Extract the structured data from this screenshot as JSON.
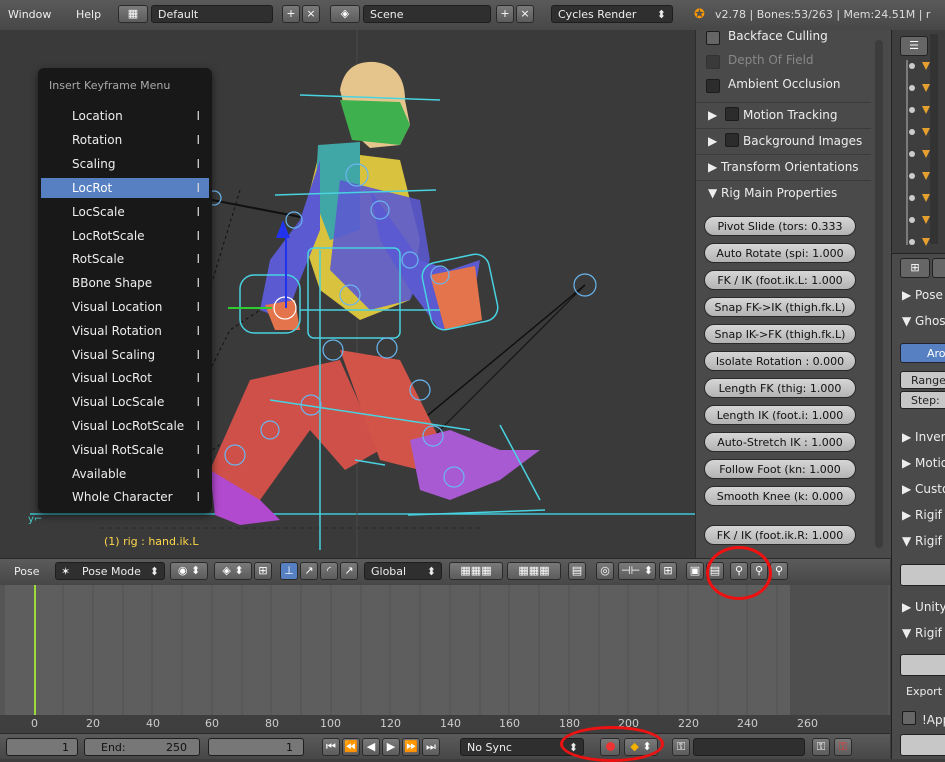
{
  "topbar": {
    "menu_window": "Window",
    "menu_help": "Help",
    "layout": "Default",
    "scene": "Scene",
    "render_engine": "Cycles Render",
    "stats": "v2.78 | Bones:53/263 | Mem:24.51M | r"
  },
  "kf_menu": {
    "title": "Insert Keyframe Menu",
    "items": [
      {
        "label": "Location",
        "shortcut": "I"
      },
      {
        "label": "Rotation",
        "shortcut": "I"
      },
      {
        "label": "Scaling",
        "shortcut": "I"
      },
      {
        "label": "LocRot",
        "shortcut": "I"
      },
      {
        "label": "LocScale",
        "shortcut": "I"
      },
      {
        "label": "LocRotScale",
        "shortcut": "I"
      },
      {
        "label": "RotScale",
        "shortcut": "I"
      },
      {
        "label": "BBone Shape",
        "shortcut": "I"
      },
      {
        "label": "Visual Location",
        "shortcut": "I"
      },
      {
        "label": "Visual Rotation",
        "shortcut": "I"
      },
      {
        "label": "Visual Scaling",
        "shortcut": "I"
      },
      {
        "label": "Visual LocRot",
        "shortcut": "I"
      },
      {
        "label": "Visual LocScale",
        "shortcut": "I"
      },
      {
        "label": "Visual LocRotScale",
        "shortcut": "I"
      },
      {
        "label": "Visual RotScale",
        "shortcut": "I"
      },
      {
        "label": "Available",
        "shortcut": "I"
      },
      {
        "label": "Whole Character",
        "shortcut": "I"
      }
    ]
  },
  "viewport": {
    "rig_label": "(1) rig : hand.ik.L"
  },
  "props": {
    "backface": "Backface Culling",
    "dof": "Depth Of Field",
    "ao": "Ambient Occlusion",
    "motion_tracking": "Motion Tracking",
    "background_images": "Background Images",
    "transform_orient": "Transform Orientations",
    "rig_main": "Rig Main Properties",
    "pills": [
      "Pivot Slide (tors: 0.333",
      "Auto Rotate (spi: 1.000",
      "FK / IK (foot.ik.L: 1.000",
      "Snap FK->IK (thigh.fk.L)",
      "Snap IK->FK (thigh.fk.L)",
      "Isolate Rotation : 0.000",
      "Length FK (thig: 1.000",
      "Length IK (foot.i: 1.000",
      "Auto-Stretch IK : 1.000",
      "Follow Foot (kn: 1.000",
      "Smooth Knee (k: 0.000",
      "FK / IK (foot.ik.R: 1.000"
    ]
  },
  "right_props": {
    "rows": [
      "Pose",
      "Ghos",
      "Aro",
      "Range",
      "Step:",
      "Inver",
      "Motio",
      "Custo",
      "Rigif",
      "Rigif",
      "Unity",
      "Rigif",
      "Export",
      "!App"
    ]
  },
  "hdr3d": {
    "editor": "Pose",
    "mode": "Pose Mode",
    "orientation": "Global"
  },
  "timeline": {
    "ticks": [
      "0",
      "20",
      "40",
      "60",
      "80",
      "100",
      "120",
      "140",
      "160",
      "180",
      "200",
      "220",
      "240",
      "260"
    ],
    "start": "1",
    "end_label": "End:",
    "end": "250",
    "current": "1",
    "sync": "No Sync"
  },
  "colors": {
    "accent": "#5680c2",
    "highlight": "#e11111",
    "rig_label": "#ffd84a"
  }
}
